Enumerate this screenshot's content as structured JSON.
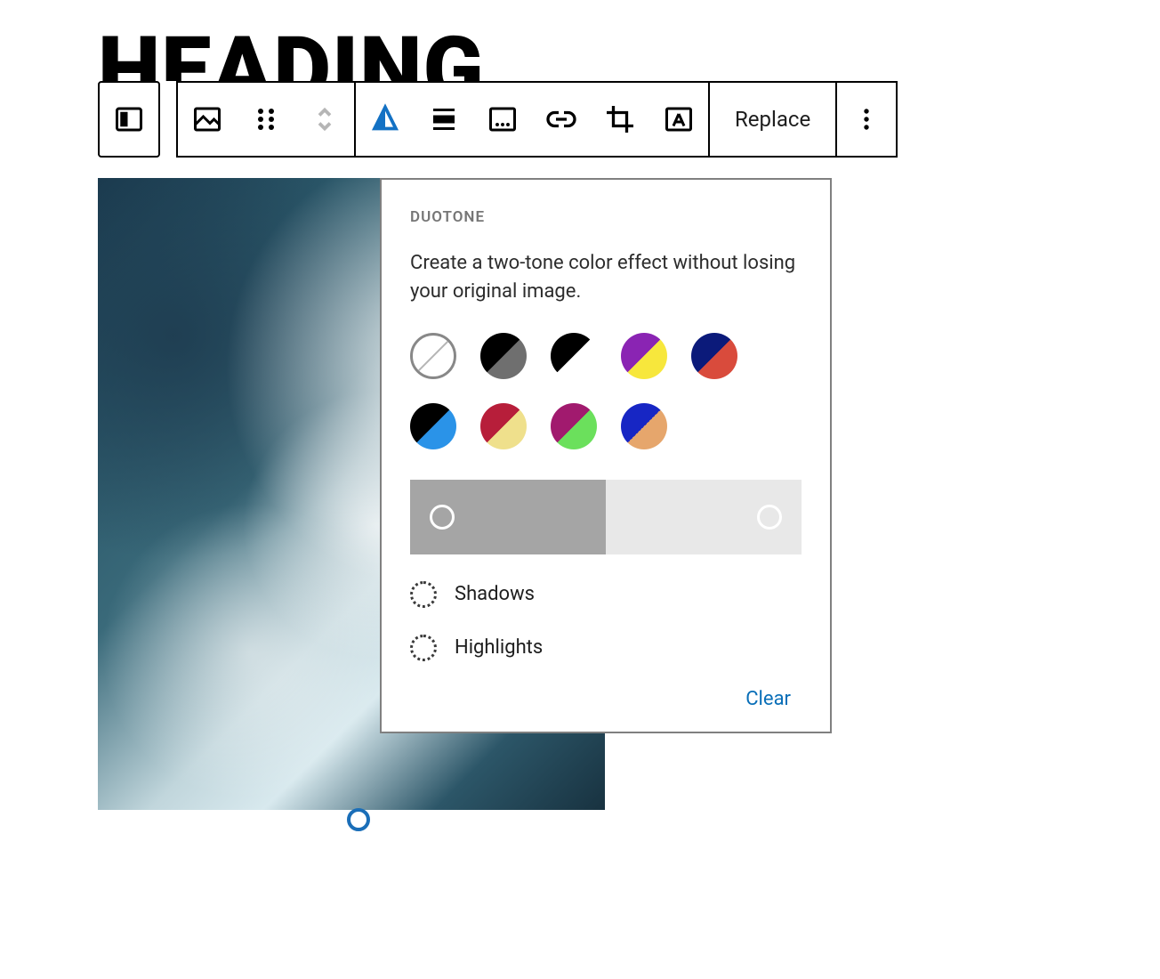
{
  "heading": "HEADING",
  "toolbar": {
    "replace_label": "Replace"
  },
  "duotone": {
    "title": "DUOTONE",
    "description": "Create a two-tone color effect without losing your original image.",
    "swatches": [
      {
        "c1": "#000000",
        "c2": "#6f6f6f"
      },
      {
        "c1": "#000000",
        "c2": "#ffffff"
      },
      {
        "c1": "#8a24b3",
        "c2": "#f7e73c"
      },
      {
        "c1": "#0b1a7a",
        "c2": "#d94b3c"
      },
      {
        "c1": "#000000",
        "c2": "#2a93e8"
      },
      {
        "c1": "#b71e3a",
        "c2": "#efe08c"
      },
      {
        "c1": "#a11a6e",
        "c2": "#6be05c"
      },
      {
        "c1": "#1726c4",
        "c2": "#e6a66c"
      }
    ],
    "shadows_label": "Shadows",
    "highlights_label": "Highlights",
    "clear_label": "Clear"
  }
}
